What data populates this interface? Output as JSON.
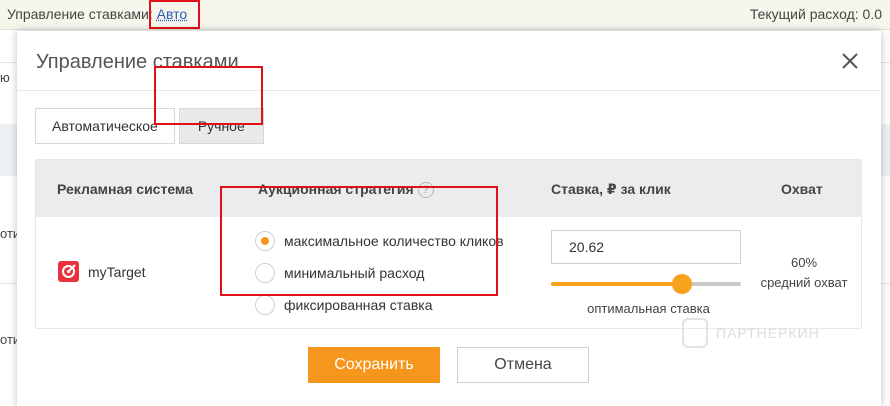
{
  "topbar": {
    "label": "Управление ставками:",
    "mode_link": "Авто",
    "spend": "Текущий расход: 0.0"
  },
  "background": {
    "fragment_1": "ю",
    "fragment_2": "оти",
    "fragment_3": "оти"
  },
  "modal": {
    "title": "Управление ставками",
    "tabs": [
      {
        "label": "Автоматическое",
        "active": false
      },
      {
        "label": "Ручное",
        "active": true
      }
    ],
    "table": {
      "headers": {
        "system": "Рекламная система",
        "strategy": "Аукционная стратегия",
        "bid": "Ставка, ₽ за клик",
        "coverage": "Охват"
      },
      "help_icon_glyph": "?",
      "row": {
        "system_name": "myTarget",
        "strategies": [
          {
            "label": "максимальное количество кликов",
            "selected": true
          },
          {
            "label": "минимальный расход",
            "selected": false
          },
          {
            "label": "фиксированная ставка",
            "selected": false
          }
        ],
        "bid_value": "20.62",
        "slider_fraction": 0.69,
        "slider_caption": "оптимальная ставка",
        "coverage_percent": "60%",
        "coverage_label": "средний охват"
      }
    },
    "buttons": {
      "save": "Сохранить",
      "cancel": "Отмена"
    }
  },
  "watermark": "ПАРТНЕРКИН",
  "colors": {
    "accent_orange": "#f7961d",
    "highlight_red": "#e0101a",
    "link_blue": "#2a5fb3",
    "mytarget_red": "#e8323c"
  }
}
